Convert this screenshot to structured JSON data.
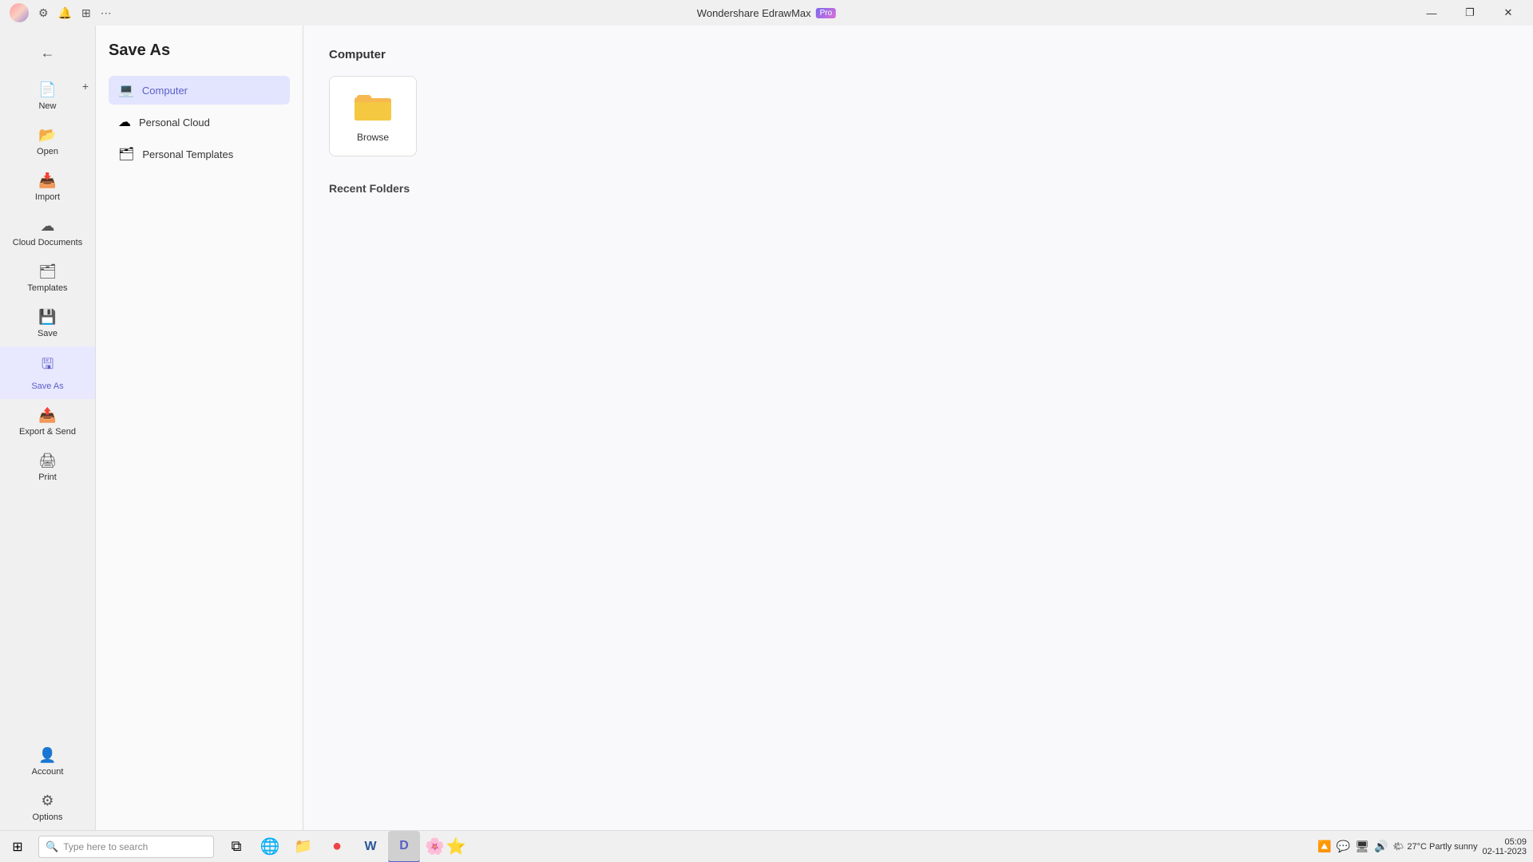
{
  "titleBar": {
    "appName": "Wondershare EdrawMax",
    "badge": "Pro",
    "btnMinimize": "—",
    "btnRestore": "❐",
    "btnClose": "✕"
  },
  "titleBarIcons": [
    {
      "name": "settings-icon",
      "symbol": "⚙",
      "label": "Settings"
    },
    {
      "name": "bell-icon",
      "symbol": "🔔",
      "label": "Notifications"
    },
    {
      "name": "share-icon",
      "symbol": "⊞",
      "label": "Share"
    },
    {
      "name": "more-icon",
      "symbol": "⋯",
      "label": "More"
    }
  ],
  "sidebar": {
    "navItems": [
      {
        "id": "new",
        "label": "New",
        "icon": "📄",
        "hasPlus": true
      },
      {
        "id": "open",
        "label": "Open",
        "icon": "📂",
        "hasPlus": false
      },
      {
        "id": "import",
        "label": "Import",
        "icon": "📥",
        "hasPlus": false
      },
      {
        "id": "cloud-documents",
        "label": "Cloud Documents",
        "icon": "☁",
        "hasPlus": false
      },
      {
        "id": "templates",
        "label": "Templates",
        "icon": "🗂",
        "hasPlus": false
      },
      {
        "id": "save",
        "label": "Save",
        "icon": "💾",
        "hasPlus": false
      },
      {
        "id": "save-as",
        "label": "Save As",
        "icon": "🖫",
        "hasPlus": false,
        "active": true
      },
      {
        "id": "export-send",
        "label": "Export & Send",
        "icon": "📤",
        "hasPlus": false
      },
      {
        "id": "print",
        "label": "Print",
        "icon": "🖨",
        "hasPlus": false
      }
    ],
    "bottomItems": [
      {
        "id": "account",
        "label": "Account",
        "icon": "👤"
      },
      {
        "id": "options",
        "label": "Options",
        "icon": "⚙"
      }
    ]
  },
  "panel": {
    "title": "Save As",
    "subNavItems": [
      {
        "id": "computer",
        "label": "Computer",
        "icon": "💻",
        "active": true
      },
      {
        "id": "personal-cloud",
        "label": "Personal Cloud",
        "icon": "☁",
        "active": false
      },
      {
        "id": "personal-templates",
        "label": "Personal Templates",
        "icon": "🗂",
        "active": false
      }
    ]
  },
  "main": {
    "sectionTitle": "Computer",
    "browseCard": {
      "label": "Browse"
    },
    "recentFolders": {
      "title": "Recent Folders"
    }
  },
  "taskbar": {
    "searchPlaceholder": "Type here to search",
    "apps": [
      {
        "id": "start",
        "icon": "⊞",
        "label": "Start"
      },
      {
        "id": "task-view",
        "icon": "⧉",
        "label": "Task View"
      },
      {
        "id": "edge",
        "icon": "🌐",
        "label": "Microsoft Edge"
      },
      {
        "id": "file-explorer",
        "icon": "📁",
        "label": "File Explorer"
      },
      {
        "id": "chrome",
        "icon": "●",
        "label": "Chrome"
      },
      {
        "id": "word",
        "icon": "W",
        "label": "Word"
      },
      {
        "id": "edraw",
        "icon": "D",
        "label": "EdrawMax",
        "active": true
      }
    ],
    "weather": "27°C Partly sunny",
    "time": "05:09",
    "date": "02-11-2023",
    "systemIcons": [
      "🔼",
      "💬",
      "🖥",
      "🔊"
    ]
  }
}
